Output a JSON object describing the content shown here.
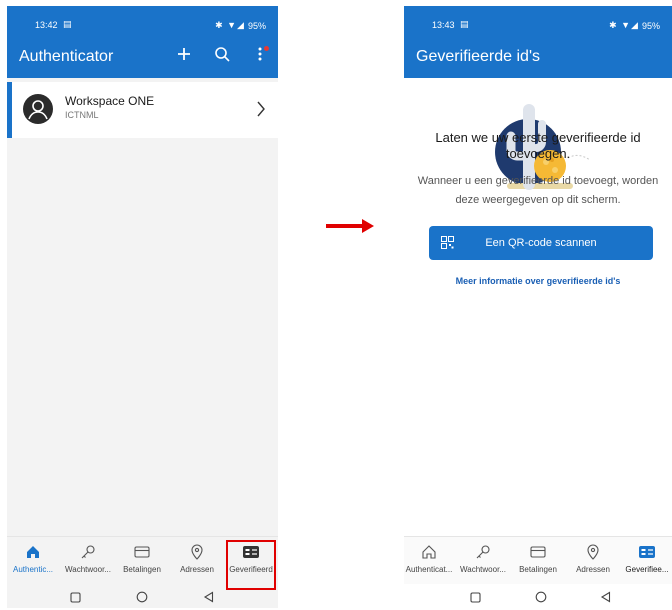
{
  "left_screen": {
    "status": {
      "time": "13:42",
      "battery": "95%"
    },
    "app_title": "Authenticator",
    "account": {
      "name": "Workspace ONE",
      "org": "ICTNML"
    },
    "nav": [
      {
        "label": "Authentic...",
        "icon": "home-icon"
      },
      {
        "label": "Wachtwoor...",
        "icon": "key-icon"
      },
      {
        "label": "Betalingen",
        "icon": "card-icon"
      },
      {
        "label": "Adressen",
        "icon": "location-icon"
      },
      {
        "label": "Geverifieerd",
        "icon": "id-card-icon"
      }
    ]
  },
  "right_screen": {
    "status": {
      "time": "13:43",
      "battery": "95%"
    },
    "app_title": "Geverifieerde id's",
    "empty_title": "Laten we uw eerste geverifieerde id toevoegen.",
    "empty_desc": "Wanneer u een geverifieerde id toevoegt, worden deze weergegeven op dit scherm.",
    "qr_button_label": "Een QR-code scannen",
    "more_link": "Meer informatie over geverifieerde id's",
    "nav": [
      {
        "label": "Authenticat...",
        "icon": "home-icon"
      },
      {
        "label": "Wachtwoor...",
        "icon": "key-icon"
      },
      {
        "label": "Betalingen",
        "icon": "card-icon"
      },
      {
        "label": "Adressen",
        "icon": "location-icon"
      },
      {
        "label": "Geverifiee...",
        "icon": "id-card-icon"
      }
    ]
  },
  "colors": {
    "accent": "#1a73c9",
    "highlight": "#e00000",
    "arrow": "#e00000"
  }
}
